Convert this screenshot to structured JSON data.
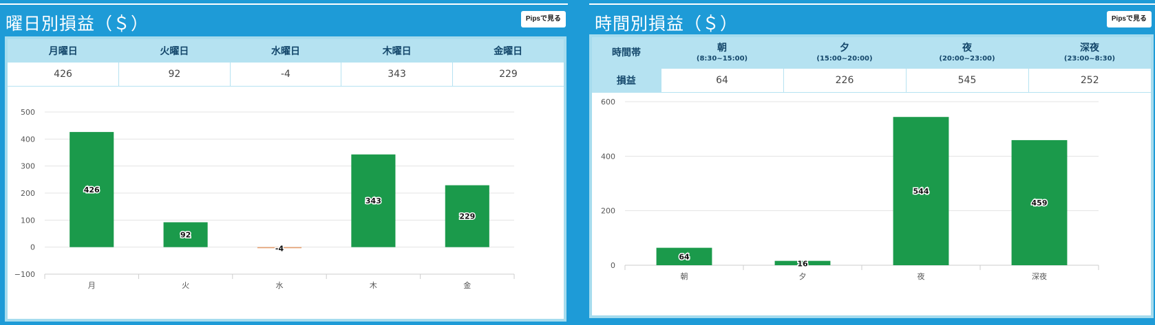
{
  "weekday_panel": {
    "title": "曜日別損益（＄）",
    "pips_button": "Pipsで見る",
    "headers": [
      "月曜日",
      "火曜日",
      "水曜日",
      "木曜日",
      "金曜日"
    ],
    "values": [
      "426",
      "92",
      "-4",
      "343",
      "229"
    ]
  },
  "hourly_panel": {
    "title": "時間別損益（＄）",
    "pips_button": "Pipsで見る",
    "row_header_label": "時間帯",
    "pnl_label": "損益",
    "columns": [
      {
        "name": "朝",
        "range": "(8:30~15:00)"
      },
      {
        "name": "夕",
        "range": "(15:00~20:00)"
      },
      {
        "name": "夜",
        "range": "(20:00~23:00)"
      },
      {
        "name": "深夜",
        "range": "(23:00~8:30)"
      }
    ],
    "values": [
      "64",
      "226",
      "545",
      "252"
    ]
  },
  "colors": {
    "background": "#1e9bd7",
    "header_fill": "#b5e2f1",
    "header_text": "#14476b",
    "bar_positive": "#1b9a4b",
    "bar_negative": "#e8a070"
  },
  "chart_data": [
    {
      "type": "bar",
      "categories": [
        "月",
        "火",
        "水",
        "木",
        "金"
      ],
      "values": [
        426,
        92,
        -4,
        343,
        229
      ],
      "data_labels": [
        "426",
        "92",
        "-4",
        "343",
        "229"
      ],
      "yticks": [
        -100,
        0,
        100,
        200,
        300,
        400,
        500
      ],
      "ylim": [
        -100,
        500
      ],
      "title": "",
      "xlabel": "",
      "ylabel": "",
      "grid": true
    },
    {
      "type": "bar",
      "categories": [
        "朝",
        "夕",
        "夜",
        "深夜"
      ],
      "values": [
        64,
        16,
        544,
        459
      ],
      "data_labels": [
        "64",
        "16",
        "544",
        "459"
      ],
      "yticks": [
        0,
        200,
        400,
        600
      ],
      "ylim": [
        0,
        600
      ],
      "title": "",
      "xlabel": "",
      "ylabel": "",
      "grid": true
    }
  ]
}
